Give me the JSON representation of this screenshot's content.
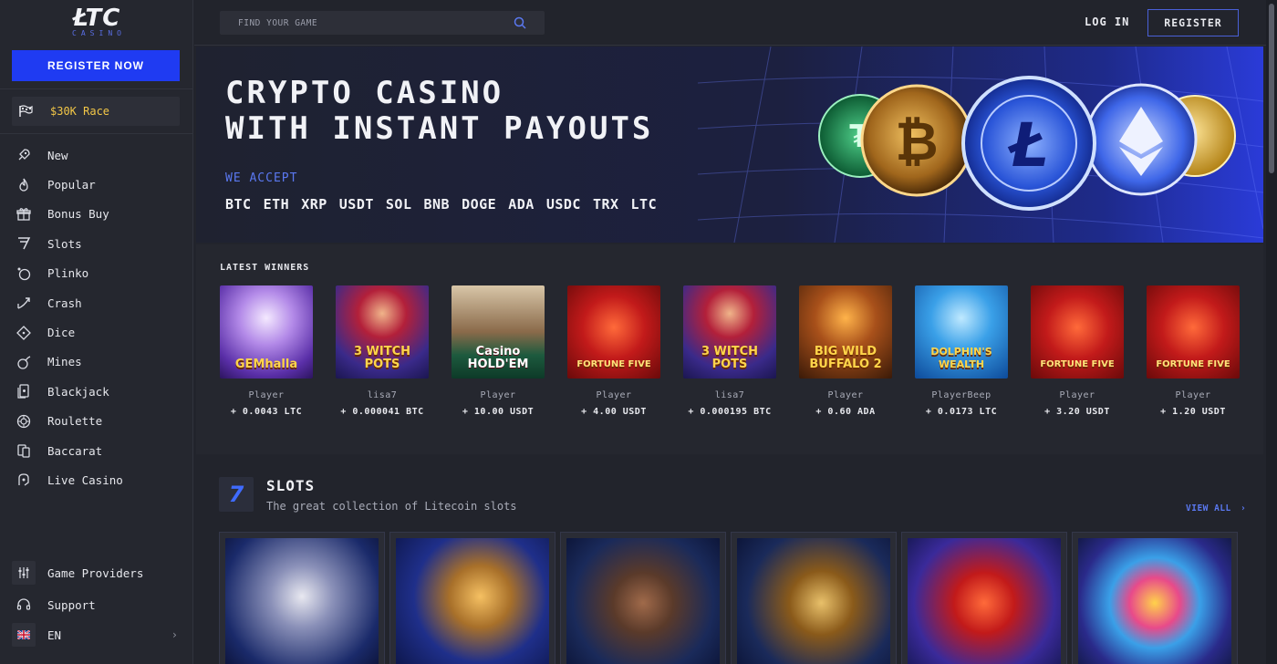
{
  "logo": {
    "main": "ŁTC",
    "sub": "CASINO"
  },
  "sidebar": {
    "register_now": "REGISTER NOW",
    "race": "$30K Race",
    "items": [
      {
        "label": "New",
        "icon": "rocket-icon"
      },
      {
        "label": "Popular",
        "icon": "flame-icon"
      },
      {
        "label": "Bonus Buy",
        "icon": "gift-icon"
      },
      {
        "label": "Slots",
        "icon": "seven-icon"
      },
      {
        "label": "Plinko",
        "icon": "plinko-icon"
      },
      {
        "label": "Crash",
        "icon": "crash-icon"
      },
      {
        "label": "Dice",
        "icon": "dice-icon"
      },
      {
        "label": "Mines",
        "icon": "bomb-icon"
      },
      {
        "label": "Blackjack",
        "icon": "cards-icon"
      },
      {
        "label": "Roulette",
        "icon": "roulette-icon"
      },
      {
        "label": "Baccarat",
        "icon": "baccarat-icon"
      },
      {
        "label": "Live Casino",
        "icon": "live-icon"
      }
    ],
    "game_providers": "Game Providers",
    "support": "Support",
    "language": "EN"
  },
  "header": {
    "search_placeholder": "FIND YOUR GAME",
    "login": "LOG IN",
    "register": "REGISTER"
  },
  "hero": {
    "title_line1": "CRYPTO CASINO",
    "title_line2": "WITH INSTANT PAYOUTS",
    "we_accept": "WE ACCEPT",
    "coins": [
      "BTC",
      "ETH",
      "XRP",
      "USDT",
      "SOL",
      "BNB",
      "DOGE",
      "ADA",
      "USDC",
      "TRX",
      "LTC"
    ]
  },
  "winners": {
    "title": "LATEST WINNERS",
    "items": [
      {
        "player": "Player",
        "amount": "+ 0.0043 LTC",
        "game": "GEMhalla"
      },
      {
        "player": "lisa7",
        "amount": "+ 0.000041 BTC",
        "game": "3 WITCH POTS"
      },
      {
        "player": "Player",
        "amount": "+ 10.00 USDT",
        "game": "Casino HOLD'EM"
      },
      {
        "player": "Player",
        "amount": "+ 4.00 USDT",
        "game": "FORTUNE FIVE"
      },
      {
        "player": "lisa7",
        "amount": "+ 0.000195 BTC",
        "game": "3 WITCH POTS"
      },
      {
        "player": "Player",
        "amount": "+ 0.60 ADA",
        "game": "BIG WILD BUFFALO 2"
      },
      {
        "player": "PlayerBeep",
        "amount": "+ 0.0173 LTC",
        "game": "DOLPHIN'S WEALTH"
      },
      {
        "player": "Player",
        "amount": "+ 3.20 USDT",
        "game": "FORTUNE FIVE"
      },
      {
        "player": "Player",
        "amount": "+ 1.20 USDT",
        "game": "FORTUNE FIVE"
      }
    ]
  },
  "slots": {
    "badge": "7",
    "title": "SLOTS",
    "subtitle": "The great collection of Litecoin slots",
    "view_all": "VIEW ALL"
  },
  "colors": {
    "accent": "#1f3bf2",
    "link": "#5a78f0",
    "race": "#f3c747",
    "background": "#22242c"
  }
}
